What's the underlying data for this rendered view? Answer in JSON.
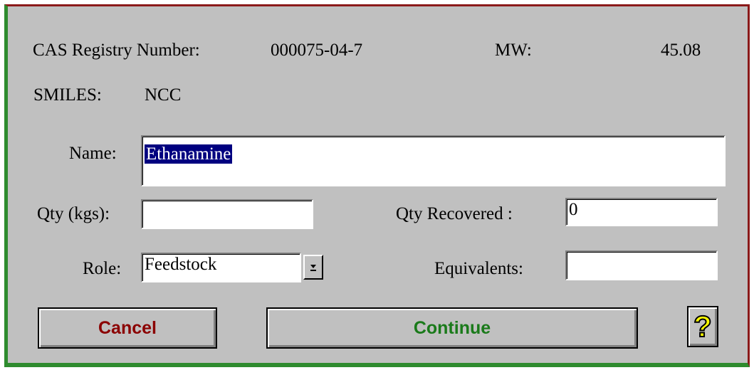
{
  "header": {
    "cas_label": "CAS Registry Number:",
    "cas_value": "000075-04-7",
    "mw_label": "MW:",
    "mw_value": "45.08",
    "smiles_label": "SMILES:",
    "smiles_value": "NCC"
  },
  "form": {
    "name_label": "Name:",
    "name_value": "Ethanamine",
    "qty_label": "Qty (kgs):",
    "qty_value": "",
    "qty_recovered_label": "Qty Recovered :",
    "qty_recovered_value": "0",
    "role_label": "Role:",
    "role_value": "Feedstock",
    "equivalents_label": "Equivalents:",
    "equivalents_value": ""
  },
  "buttons": {
    "cancel_label": "Cancel",
    "continue_label": "Continue",
    "help_label": "?"
  },
  "colors": {
    "cancel_text": "#8b0000",
    "continue_text": "#1a7a1a",
    "help_glyph": "#ffff00"
  }
}
